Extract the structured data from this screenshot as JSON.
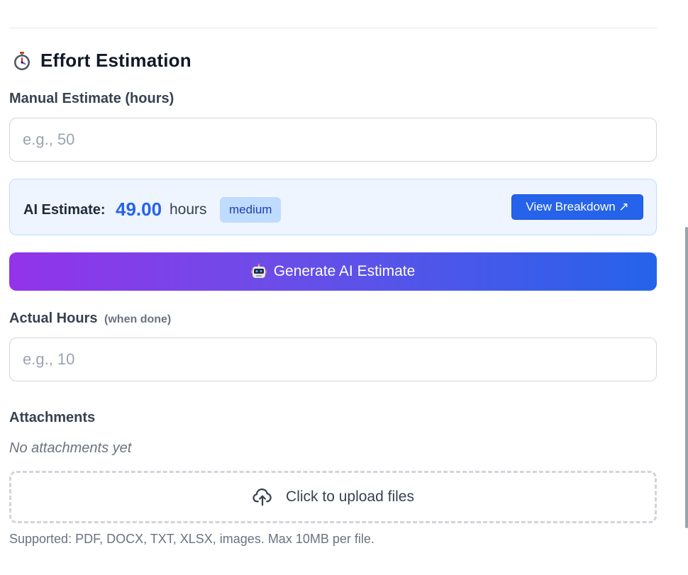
{
  "section": {
    "title": "Effort Estimation",
    "icon": "stopwatch-icon"
  },
  "manual_estimate": {
    "label": "Manual Estimate (hours)",
    "placeholder": "e.g., 50",
    "value": ""
  },
  "ai_estimate": {
    "label": "AI Estimate:",
    "value": "49.00",
    "unit": "hours",
    "confidence": "medium",
    "breakdown_button": "View Breakdown ↗"
  },
  "generate_button": {
    "label": "Generate AI Estimate",
    "icon": "robot-icon"
  },
  "actual_hours": {
    "label": "Actual Hours",
    "sublabel": "(when done)",
    "placeholder": "e.g., 10",
    "value": ""
  },
  "attachments": {
    "label": "Attachments",
    "empty_text": "No attachments yet",
    "upload_label": "Click to upload files",
    "upload_icon": "cloud-upload-icon",
    "supported_text": "Supported: PDF, DOCX, TXT, XLSX, images. Max 10MB per file."
  },
  "colors": {
    "accent": "#2563eb",
    "gradient_start": "#9333ea",
    "gradient_end": "#2563eb",
    "ai_box_bg": "#eef5ff",
    "badge_bg": "#bfdbfe"
  }
}
